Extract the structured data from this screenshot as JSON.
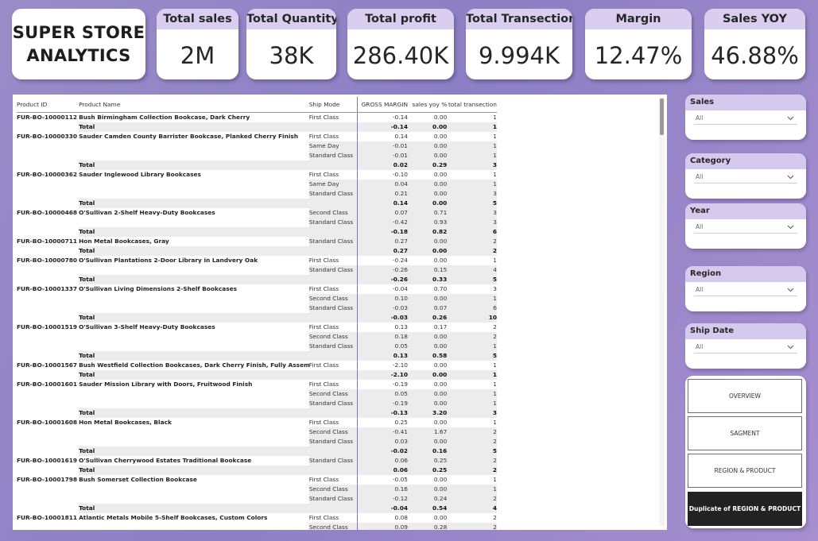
{
  "header": {
    "logo_text": "SUPER STORE\nANALYTICS",
    "kpis": [
      {
        "title": "Total sales",
        "value": "2M"
      },
      {
        "title": "Total Quantity",
        "value": "38K"
      },
      {
        "title": "Total profit",
        "value": "286.40K"
      },
      {
        "title": "Total Transection",
        "value": "9.994K"
      },
      {
        "title": "Margin",
        "value": "12.47%"
      },
      {
        "title": "Sales YOY",
        "value": "46.88%"
      }
    ]
  },
  "table": {
    "columns": [
      "Product ID",
      "Product Name",
      "Ship Mode",
      "GROSS MARGIN",
      "sales yoy %",
      "total transection"
    ],
    "rows": [
      {
        "type": "row",
        "pid": "FUR-BO-10000112",
        "pname": "Bush Birmingham Collection Bookcase, Dark Cherry",
        "ship": "First Class",
        "gm": "-0.14",
        "yoy": "0.00",
        "tt": "1"
      },
      {
        "type": "total",
        "label": "Total",
        "gm": "-0.14",
        "yoy": "0.00",
        "tt": "1"
      },
      {
        "type": "row",
        "pid": "FUR-BO-10000330",
        "pname": "Sauder Camden County Barrister Bookcase, Planked Cherry Finish",
        "ship": "First Class",
        "gm": "0.14",
        "yoy": "0.00",
        "tt": "1"
      },
      {
        "type": "row",
        "ship": "Same Day",
        "gm": "-0.01",
        "yoy": "0.00",
        "tt": "1"
      },
      {
        "type": "row",
        "ship": "Standard Class",
        "gm": "-0.01",
        "yoy": "0.00",
        "tt": "1"
      },
      {
        "type": "total",
        "label": "Total",
        "gm": "0.02",
        "yoy": "0.29",
        "tt": "3"
      },
      {
        "type": "row",
        "pid": "FUR-BO-10000362",
        "pname": "Sauder Inglewood Library Bookcases",
        "ship": "First Class",
        "gm": "-0.10",
        "yoy": "0.00",
        "tt": "1"
      },
      {
        "type": "row",
        "ship": "Same Day",
        "gm": "0.04",
        "yoy": "0.00",
        "tt": "1"
      },
      {
        "type": "row",
        "ship": "Standard Class",
        "gm": "0.21",
        "yoy": "0.00",
        "tt": "3"
      },
      {
        "type": "total",
        "label": "Total",
        "gm": "0.14",
        "yoy": "0.00",
        "tt": "5"
      },
      {
        "type": "row",
        "pid": "FUR-BO-10000468",
        "pname": "O'Sullivan 2-Shelf Heavy-Duty Bookcases",
        "ship": "Second Class",
        "gm": "0.07",
        "yoy": "0.71",
        "tt": "3"
      },
      {
        "type": "row",
        "ship": "Standard Class",
        "gm": "-0.42",
        "yoy": "0.93",
        "tt": "3"
      },
      {
        "type": "total",
        "label": "Total",
        "gm": "-0.18",
        "yoy": "0.82",
        "tt": "6"
      },
      {
        "type": "row",
        "pid": "FUR-BO-10000711",
        "pname": "Hon Metal Bookcases, Gray",
        "ship": "Standard Class",
        "gm": "0.27",
        "yoy": "0.00",
        "tt": "2"
      },
      {
        "type": "total",
        "label": "Total",
        "gm": "0.27",
        "yoy": "0.00",
        "tt": "2"
      },
      {
        "type": "row",
        "pid": "FUR-BO-10000780",
        "pname": "O'Sullivan Plantations 2-Door Library in Landvery Oak",
        "ship": "First Class",
        "gm": "-0.24",
        "yoy": "0.00",
        "tt": "1"
      },
      {
        "type": "row",
        "ship": "Standard Class",
        "gm": "-0.26",
        "yoy": "0.15",
        "tt": "4"
      },
      {
        "type": "total",
        "label": "Total",
        "gm": "-0.26",
        "yoy": "0.33",
        "tt": "5"
      },
      {
        "type": "row",
        "pid": "FUR-BO-10001337",
        "pname": "O'Sullivan Living Dimensions 2-Shelf Bookcases",
        "ship": "First Class",
        "gm": "-0.04",
        "yoy": "0.70",
        "tt": "3"
      },
      {
        "type": "row",
        "ship": "Second Class",
        "gm": "0.10",
        "yoy": "0.00",
        "tt": "1"
      },
      {
        "type": "row",
        "ship": "Standard Class",
        "gm": "-0.03",
        "yoy": "0.07",
        "tt": "6"
      },
      {
        "type": "total",
        "label": "Total",
        "gm": "-0.03",
        "yoy": "0.26",
        "tt": "10"
      },
      {
        "type": "row",
        "pid": "FUR-BO-10001519",
        "pname": "O'Sullivan 3-Shelf Heavy-Duty Bookcases",
        "ship": "First Class",
        "gm": "0.13",
        "yoy": "0.17",
        "tt": "2"
      },
      {
        "type": "row",
        "ship": "Second Class",
        "gm": "0.18",
        "yoy": "0.00",
        "tt": "2"
      },
      {
        "type": "row",
        "ship": "Standard Class",
        "gm": "0.05",
        "yoy": "0.00",
        "tt": "1"
      },
      {
        "type": "total",
        "label": "Total",
        "gm": "0.13",
        "yoy": "0.58",
        "tt": "5"
      },
      {
        "type": "row",
        "pid": "FUR-BO-10001567",
        "pname": "Bush Westfield Collection Bookcases, Dark Cherry Finish, Fully Assembled",
        "ship": "First Class",
        "gm": "-2.10",
        "yoy": "0.00",
        "tt": "1"
      },
      {
        "type": "total",
        "label": "Total",
        "gm": "-2.10",
        "yoy": "0.00",
        "tt": "1"
      },
      {
        "type": "row",
        "pid": "FUR-BO-10001601",
        "pname": "Sauder Mission Library with Doors, Fruitwood Finish",
        "ship": "First Class",
        "gm": "-0.19",
        "yoy": "0.00",
        "tt": "1"
      },
      {
        "type": "row",
        "ship": "Second Class",
        "gm": "0.05",
        "yoy": "0.00",
        "tt": "1"
      },
      {
        "type": "row",
        "ship": "Standard Class",
        "gm": "-0.19",
        "yoy": "0.00",
        "tt": "1"
      },
      {
        "type": "total",
        "label": "Total",
        "gm": "-0.13",
        "yoy": "3.20",
        "tt": "3"
      },
      {
        "type": "row",
        "pid": "FUR-BO-10001608",
        "pname": "Hon Metal Bookcases, Black",
        "ship": "First Class",
        "gm": "0.25",
        "yoy": "0.00",
        "tt": "1"
      },
      {
        "type": "row",
        "ship": "Second Class",
        "gm": "-0.41",
        "yoy": "1.67",
        "tt": "2"
      },
      {
        "type": "row",
        "ship": "Standard Class",
        "gm": "0.03",
        "yoy": "0.00",
        "tt": "2"
      },
      {
        "type": "total",
        "label": "Total",
        "gm": "-0.02",
        "yoy": "0.16",
        "tt": "5"
      },
      {
        "type": "row",
        "pid": "FUR-BO-10001619",
        "pname": "O'Sullivan Cherrywood Estates Traditional Bookcase",
        "ship": "Standard Class",
        "gm": "0.06",
        "yoy": "0.25",
        "tt": "2"
      },
      {
        "type": "total",
        "label": "Total",
        "gm": "0.06",
        "yoy": "0.25",
        "tt": "2"
      },
      {
        "type": "row",
        "pid": "FUR-BO-10001798",
        "pname": "Bush Somerset Collection Bookcase",
        "ship": "First Class",
        "gm": "-0.05",
        "yoy": "0.00",
        "tt": "1"
      },
      {
        "type": "row",
        "ship": "Second Class",
        "gm": "0.16",
        "yoy": "0.00",
        "tt": "1"
      },
      {
        "type": "row",
        "ship": "Standard Class",
        "gm": "-0.12",
        "yoy": "0.24",
        "tt": "2"
      },
      {
        "type": "total",
        "label": "Total",
        "gm": "-0.04",
        "yoy": "0.54",
        "tt": "4"
      },
      {
        "type": "row",
        "pid": "FUR-BO-10001811",
        "pname": "Atlantic Metals Mobile 5-Shelf Bookcases, Custom Colors",
        "ship": "First Class",
        "gm": "0.08",
        "yoy": "0.00",
        "tt": "2"
      },
      {
        "type": "row",
        "ship": "Second Class",
        "gm": "0.09",
        "yoy": "0.28",
        "tt": "2"
      }
    ]
  },
  "slicers": [
    {
      "title": "Sales",
      "value": "All"
    },
    {
      "title": "Category",
      "value": "All"
    },
    {
      "title": "Year",
      "value": "All"
    },
    {
      "title": "Region",
      "value": "All"
    },
    {
      "title": "Ship Date",
      "value": "All"
    }
  ],
  "nav": [
    {
      "label": "OVERVIEW"
    },
    {
      "label": "SAGMENT"
    },
    {
      "label": "REGION & PRODUCT"
    },
    {
      "label": "Duplicate of REGION & PRODUCT"
    }
  ],
  "colors": {
    "background": "#8c7fc4",
    "kpi_header": "#d9cef0",
    "slicer_header": "#d6c9ee",
    "total_row": "#ececec",
    "active_nav": "#222222"
  }
}
